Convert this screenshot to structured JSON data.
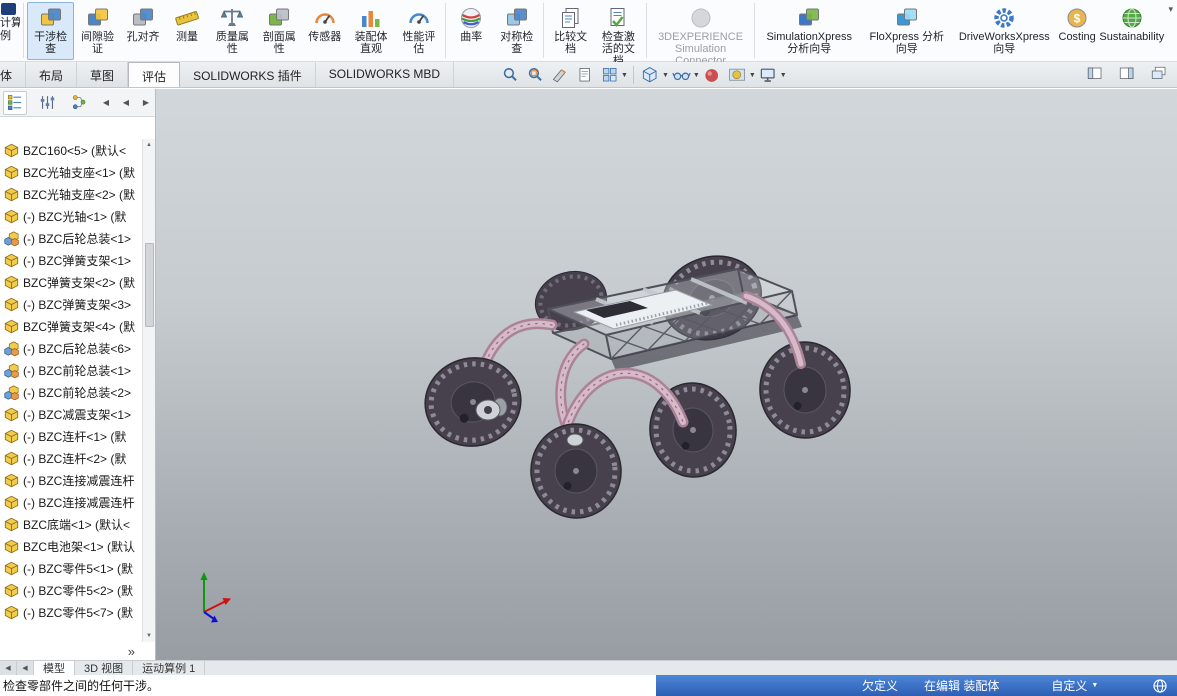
{
  "command_manager": {
    "cutoff_label": "计算例",
    "buttons": [
      {
        "name": "interference-detection-button",
        "label": "干涉检查",
        "icon": "blocks",
        "colors": [
          "#f2c53d",
          "#4a86c8"
        ],
        "active": true
      },
      {
        "name": "clearance-verification-button",
        "label": "间隙验证",
        "icon": "blocks",
        "colors": [
          "#4a86c8",
          "#f2c53d"
        ]
      },
      {
        "name": "hole-alignment-button",
        "label": "孔对齐",
        "icon": "blocks",
        "colors": [
          "#b9bfc5",
          "#4a86c8"
        ]
      },
      {
        "name": "measure-button",
        "label": "测量",
        "icon": "ruler",
        "colors": [
          "#e9c23f"
        ]
      },
      {
        "name": "mass-properties-button",
        "label": "质量属性",
        "icon": "scale",
        "colors": [
          "#6a7a8a",
          "#4a86c8"
        ]
      },
      {
        "name": "section-properties-button",
        "label": "剖面属性",
        "icon": "blocks",
        "colors": [
          "#7ab648",
          "#b9bfc5"
        ]
      },
      {
        "name": "sensor-button",
        "label": "传感器",
        "icon": "gauge",
        "colors": [
          "#e8883c"
        ]
      },
      {
        "name": "assembly-visualization-button",
        "label": "装配体直观",
        "icon": "bars",
        "colors": [
          "#4a86c8",
          "#e8883c",
          "#7ab648"
        ]
      },
      {
        "name": "performance-evaluation-button",
        "label": "性能评估",
        "icon": "gauge",
        "colors": [
          "#4a86c8"
        ],
        "sep_after": true
      },
      {
        "name": "curvature-button",
        "label": "曲率",
        "icon": "sphere",
        "colors": [
          "#d04040",
          "#40a040",
          "#4060d0"
        ]
      },
      {
        "name": "symmetry-check-button",
        "label": "对称检查",
        "icon": "blocks",
        "colors": [
          "#9ac8e8",
          "#4a86c8"
        ],
        "sep_after": true
      },
      {
        "name": "compare-documents-button",
        "label": "比较文档",
        "icon": "doc2",
        "colors": [
          "#4a86c8"
        ]
      },
      {
        "name": "check-active-document-button",
        "label": "检查激活的文档",
        "icon": "doccheck",
        "colors": [
          "#4a86c8",
          "#58a848"
        ],
        "sep_after": true
      },
      {
        "name": "simulation-connector-button",
        "label": "3DEXPERIENCE Simulation Connector",
        "icon": "circle",
        "colors": [
          "#b7bbbf"
        ],
        "disabled": true,
        "sep_after": true
      },
      {
        "name": "simulationxpress-button",
        "label": "SimulationXpress 分析向导",
        "icon": "blocks",
        "colors": [
          "#3c78c8",
          "#7ab648"
        ]
      },
      {
        "name": "floxpress-button",
        "label": "FloXpress 分析向导",
        "icon": "blocks",
        "colors": [
          "#3c98d8",
          "#9adcf8"
        ]
      },
      {
        "name": "driveworksxpress-button",
        "label": "DriveWorksXpress 向导",
        "icon": "gear",
        "colors": [
          "#3c78c8"
        ]
      },
      {
        "name": "costing-button",
        "label": "Costing",
        "icon": "circle",
        "colors": [
          "#e8b64c"
        ],
        "char": "$"
      },
      {
        "name": "sustainability-button",
        "label": "Sustainability",
        "icon": "globe",
        "colors": [
          "#58a848"
        ]
      }
    ]
  },
  "ribbon_tabs": [
    {
      "name": "tab-assembly",
      "label": "配体",
      "clipped": true
    },
    {
      "name": "tab-layout",
      "label": "布局"
    },
    {
      "name": "tab-sketch",
      "label": "草图"
    },
    {
      "name": "tab-evaluate",
      "label": "评估",
      "active": true
    },
    {
      "name": "tab-solidworks-addins",
      "label": "SOLIDWORKS 插件"
    },
    {
      "name": "tab-solidworks-mbd",
      "label": "SOLIDWORKS MBD"
    }
  ],
  "headsup": {
    "items": [
      {
        "name": "zoom-fit-icon",
        "glyph": "magnifier"
      },
      {
        "name": "zoom-area-icon",
        "glyph": "magnifier-area"
      },
      {
        "name": "section-view-icon",
        "glyph": "knife"
      },
      {
        "name": "dynamic-annotation-views-icon",
        "glyph": "page"
      },
      {
        "name": "view-orientation-icon",
        "glyph": "grid",
        "caret": true,
        "sep_after": true
      },
      {
        "name": "display-style-icon",
        "glyph": "cube",
        "caret": true
      },
      {
        "name": "hide-show-items-icon",
        "glyph": "glasses",
        "caret": true
      },
      {
        "name": "edit-appearance-icon",
        "glyph": "ball"
      },
      {
        "name": "apply-scene-icon",
        "glyph": "ball2",
        "caret": true
      },
      {
        "name": "view-settings-icon",
        "glyph": "monitor",
        "caret": true
      }
    ]
  },
  "window_controls": {
    "items": [
      {
        "name": "pane-left-icon",
        "glyph": "pane-left"
      },
      {
        "name": "pane-right-icon",
        "glyph": "pane-right"
      },
      {
        "name": "cascade-windows-icon",
        "glyph": "cascade"
      }
    ]
  },
  "feature_tree": {
    "tabs": [
      {
        "name": "featuremanager-tab-icon",
        "glyph": "fm"
      },
      {
        "name": "propertymanager-tab-icon",
        "glyph": "pm"
      },
      {
        "name": "configurationmanager-tab-icon",
        "glyph": "cm"
      }
    ],
    "nav_prev": "◀",
    "nav_next": "▶",
    "scroll_up": "▲",
    "scroll_down": "▼",
    "expand": "»",
    "items": [
      {
        "icon": "part",
        "label": "BZC160<5> (默认<"
      },
      {
        "icon": "part",
        "label": "BZC光轴支座<1> (默"
      },
      {
        "icon": "part",
        "label": "BZC光轴支座<2> (默"
      },
      {
        "icon": "part",
        "label": "(-) BZC光轴<1> (默"
      },
      {
        "icon": "assembly",
        "label": "(-) BZC后轮总装<1>"
      },
      {
        "icon": "part",
        "label": "(-) BZC弹簧支架<1>"
      },
      {
        "icon": "part",
        "label": "BZC弹簧支架<2> (默"
      },
      {
        "icon": "part",
        "label": "(-) BZC弹簧支架<3>"
      },
      {
        "icon": "part",
        "label": "BZC弹簧支架<4> (默"
      },
      {
        "icon": "assembly",
        "label": "(-) BZC后轮总装<6>"
      },
      {
        "icon": "assembly",
        "label": "(-) BZC前轮总装<1>"
      },
      {
        "icon": "assembly",
        "label": "(-) BZC前轮总装<2>"
      },
      {
        "icon": "part",
        "label": "(-) BZC减震支架<1>"
      },
      {
        "icon": "part",
        "label": "(-) BZC连杆<1> (默"
      },
      {
        "icon": "part",
        "label": "(-) BZC连杆<2> (默"
      },
      {
        "icon": "part",
        "label": "(-) BZC连接减震连杆"
      },
      {
        "icon": "part",
        "label": "(-) BZC连接减震连杆"
      },
      {
        "icon": "part",
        "label": "BZC底端<1> (默认<"
      },
      {
        "icon": "part",
        "label": "BZC电池架<1> (默认"
      },
      {
        "icon": "part",
        "label": "(-) BZC零件5<1> (默"
      },
      {
        "icon": "part",
        "label": "(-) BZC零件5<2> (默"
      },
      {
        "icon": "part",
        "label": "(-) BZC零件5<7> (默"
      }
    ]
  },
  "bottom_bar": {
    "scroll_left": "◀",
    "tabs": [
      {
        "name": "tab-model",
        "label": "模型",
        "active": true
      },
      {
        "name": "tab-3d-views",
        "label": "3D 视图"
      },
      {
        "name": "tab-motion-study",
        "label": "运动算例 1"
      }
    ]
  },
  "status_bar": {
    "message": "检查零部件之间的任何干涉。",
    "state": "欠定义",
    "edit_mode": "在编辑 装配体",
    "custom": "自定义"
  },
  "colors": {
    "accent_blue": "#2c5fb4",
    "part_yellow": "#f2cb4a",
    "arm_pink": "#c09cb0",
    "wheel_dark": "#46414d"
  }
}
